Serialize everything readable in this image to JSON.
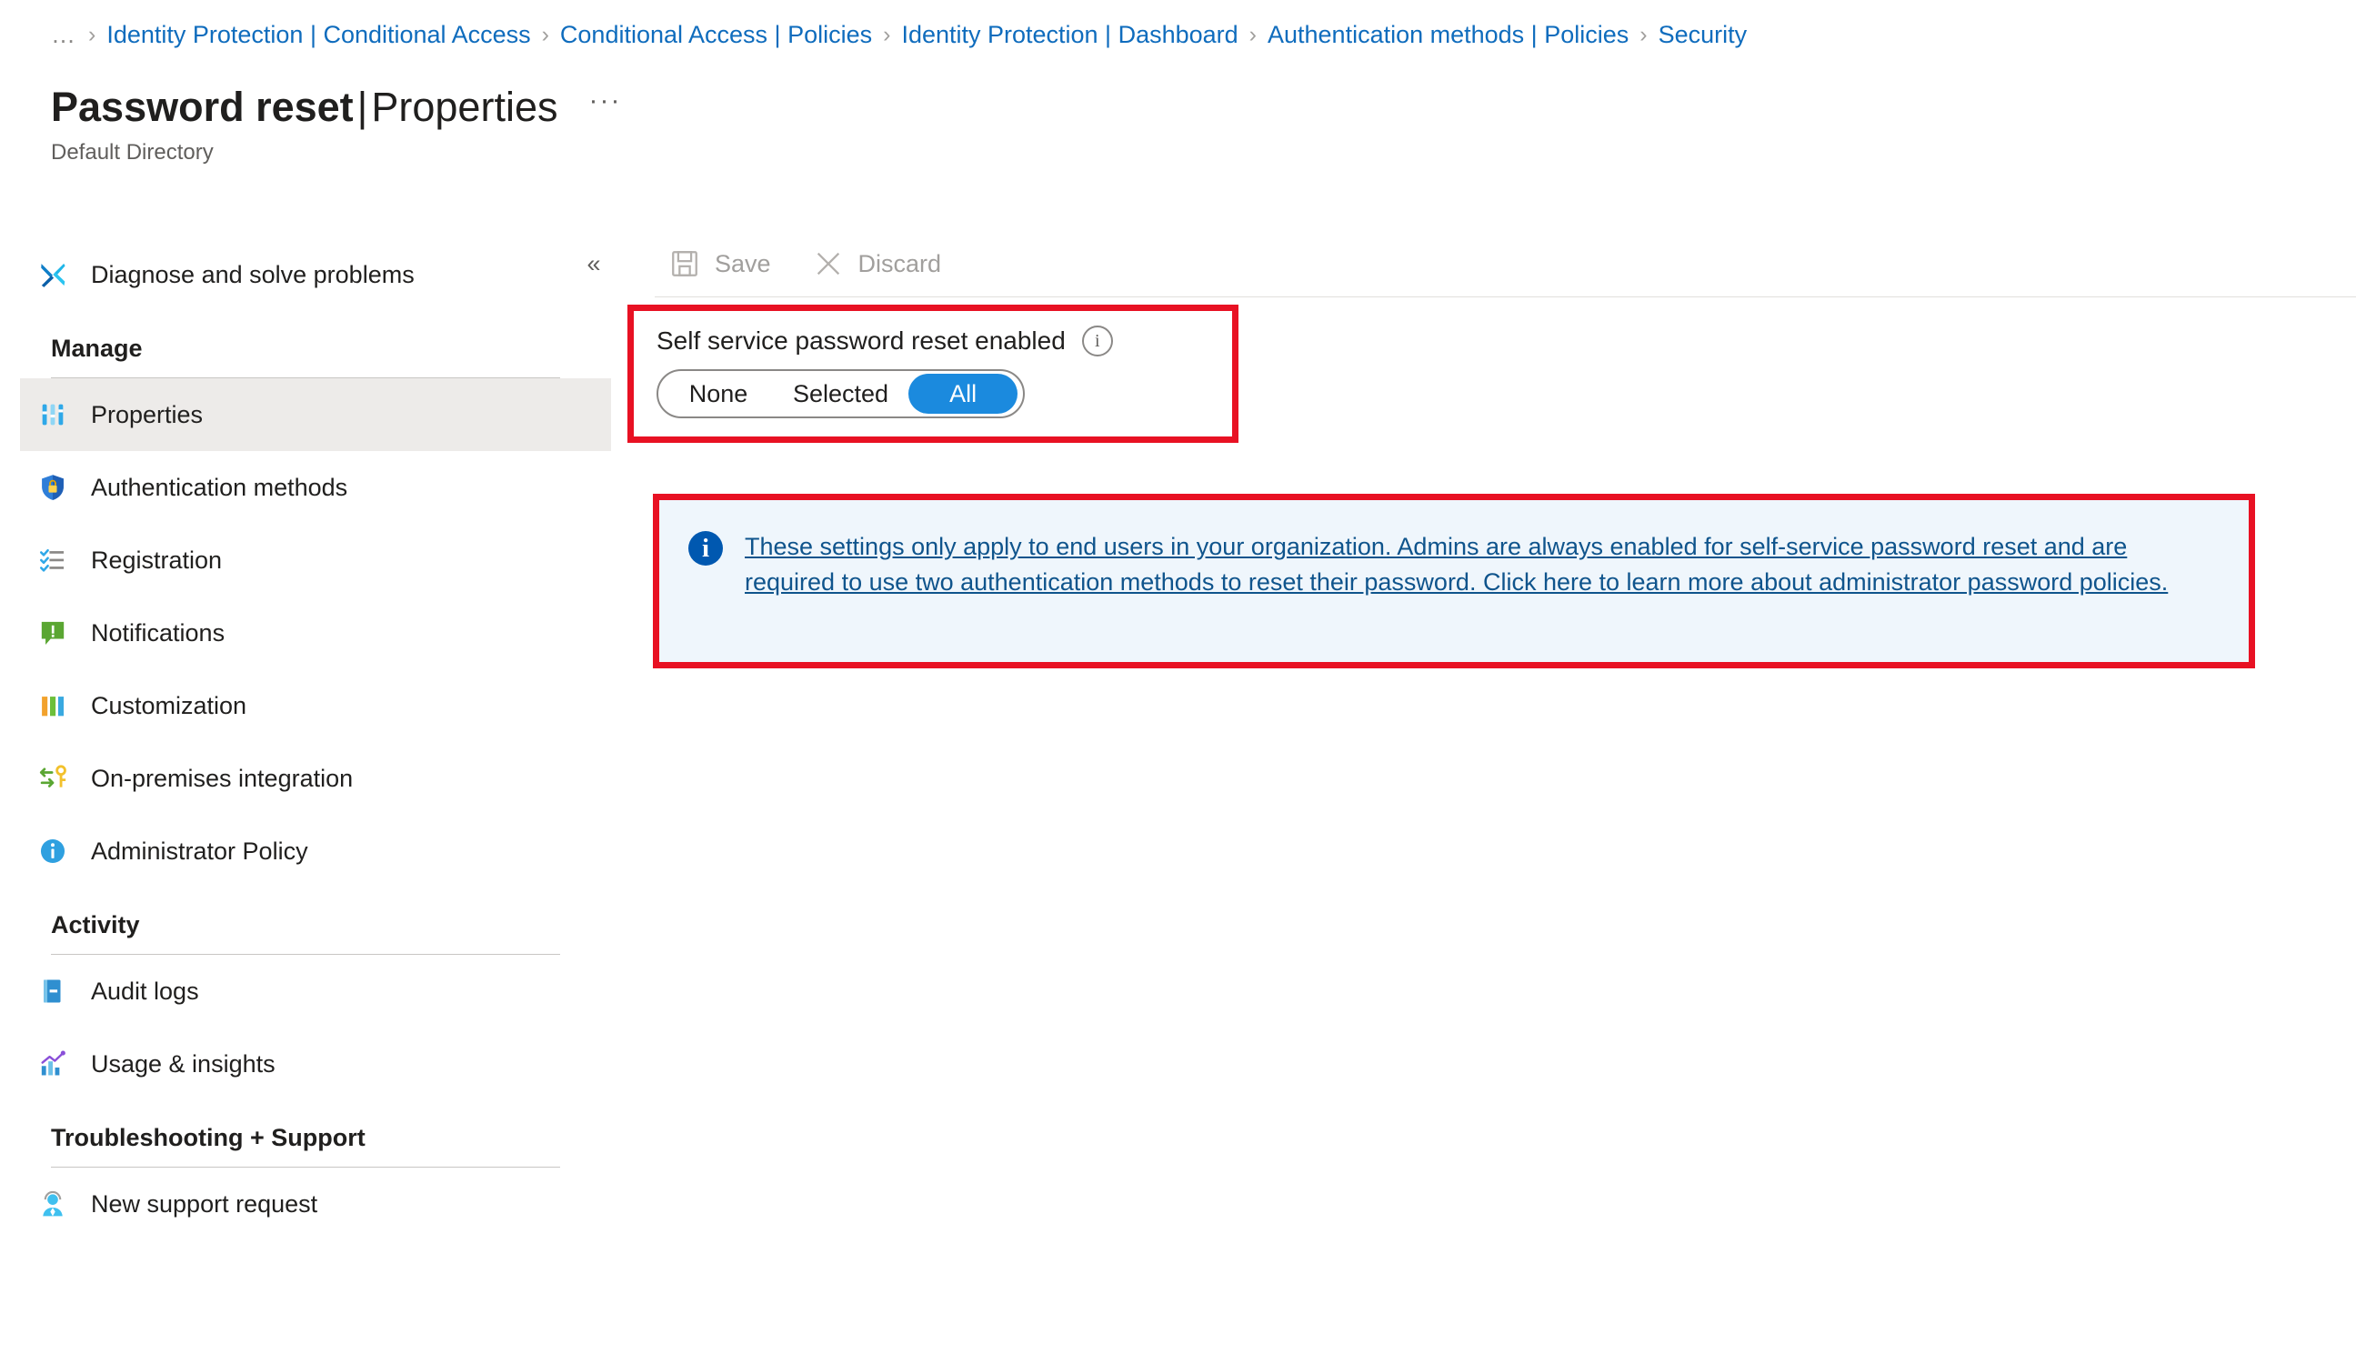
{
  "breadcrumb": {
    "items": [
      {
        "label": "…",
        "kind": "ellipsis"
      },
      {
        "label": "Identity Protection | Conditional Access",
        "kind": "link"
      },
      {
        "label": "Conditional Access | Policies",
        "kind": "link"
      },
      {
        "label": "Identity Protection | Dashboard",
        "kind": "link"
      },
      {
        "label": "Authentication methods | Policies",
        "kind": "link"
      },
      {
        "label": "Security",
        "kind": "link"
      }
    ],
    "separator": "›"
  },
  "header": {
    "title_main": "Password reset",
    "title_divider": "|",
    "title_sub": "Properties",
    "more_actions": "···",
    "subtitle": "Default Directory"
  },
  "sidebar": {
    "collapse_icon": "«",
    "top_items": [
      {
        "label": "Diagnose and solve problems",
        "icon": "wrench-screwdriver-icon",
        "selected": false
      }
    ],
    "groups": [
      {
        "title": "Manage",
        "items": [
          {
            "label": "Properties",
            "icon": "properties-bars-icon",
            "selected": true
          },
          {
            "label": "Authentication methods",
            "icon": "shield-lock-icon",
            "selected": false
          },
          {
            "label": "Registration",
            "icon": "checklist-icon",
            "selected": false
          },
          {
            "label": "Notifications",
            "icon": "notification-alert-icon",
            "selected": false
          },
          {
            "label": "Customization",
            "icon": "bar-chart-icon",
            "selected": false
          },
          {
            "label": "On-premises integration",
            "icon": "sync-key-icon",
            "selected": false
          },
          {
            "label": "Administrator Policy",
            "icon": "info-circle-icon",
            "selected": false
          }
        ]
      },
      {
        "title": "Activity",
        "items": [
          {
            "label": "Audit logs",
            "icon": "audit-book-icon",
            "selected": false
          },
          {
            "label": "Usage & insights",
            "icon": "insights-chart-icon",
            "selected": false
          }
        ]
      },
      {
        "title": "Troubleshooting + Support",
        "items": [
          {
            "label": "New support request",
            "icon": "support-person-icon",
            "selected": false
          }
        ]
      }
    ]
  },
  "toolbar": {
    "save_label": "Save",
    "discard_label": "Discard"
  },
  "main": {
    "toggle": {
      "label": "Self service password reset enabled",
      "info_glyph": "i",
      "options": [
        "None",
        "Selected",
        "All"
      ],
      "selected": "All",
      "accent_color": "#1b8ade"
    },
    "banner": {
      "icon_glyph": "i",
      "text": "These settings only apply to end users in your organization. Admins are always enabled for self-service password reset and are required to use two authentication methods to reset their password. Click here to learn more about administrator password policies.",
      "background_color": "#eff6fc",
      "link_color": "#0f548c"
    },
    "annotation_color": "#e81123"
  }
}
